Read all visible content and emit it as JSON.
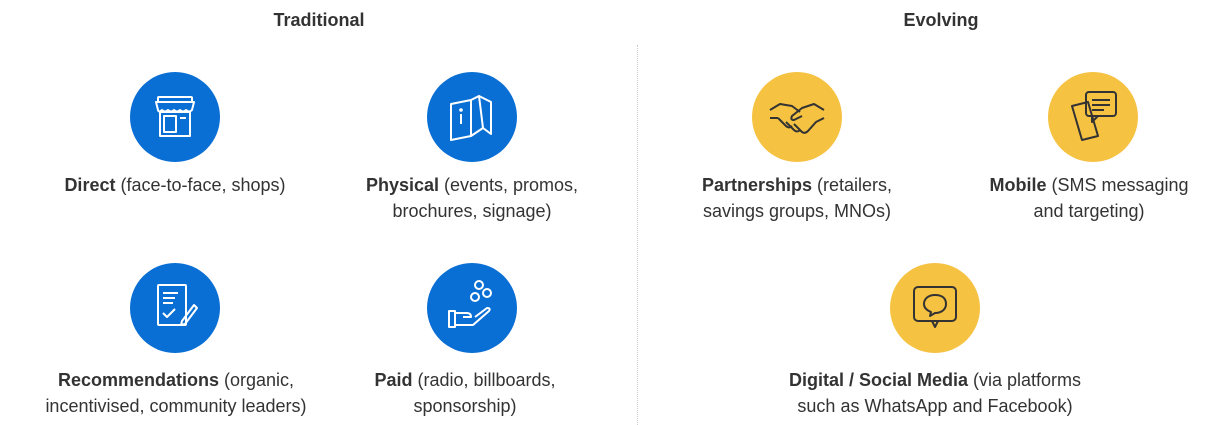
{
  "headings": {
    "traditional": "Traditional",
    "evolving": "Evolving"
  },
  "colors": {
    "traditional_icon": "#0a6fd4",
    "evolving_icon": "#f5c242"
  },
  "traditional": [
    {
      "icon": "shop-icon",
      "title": "Direct",
      "rest": "(face-to-face, shops)",
      "rest2": ""
    },
    {
      "icon": "brochure-icon",
      "title": "Physical",
      "rest": "(events, promos,",
      "rest2": "brochures, signage)"
    },
    {
      "icon": "document-check-icon",
      "title": "Recommendations",
      "rest": "(organic,",
      "rest2": "incentivised, community leaders)"
    },
    {
      "icon": "hand-coins-icon",
      "title": "Paid",
      "rest": "(radio, billboards,",
      "rest2": "sponsorship)"
    }
  ],
  "evolving": [
    {
      "icon": "handshake-icon",
      "title": "Partnerships",
      "rest": "(retailers,",
      "rest2": "savings groups, MNOs)"
    },
    {
      "icon": "mobile-message-icon",
      "title": "Mobile",
      "rest": "(SMS messaging",
      "rest2": "and targeting)"
    },
    {
      "icon": "chat-bubble-icon",
      "title": "Digital / Social Media",
      "rest": "(via platforms",
      "rest2": "such as WhatsApp and Facebook)"
    }
  ]
}
